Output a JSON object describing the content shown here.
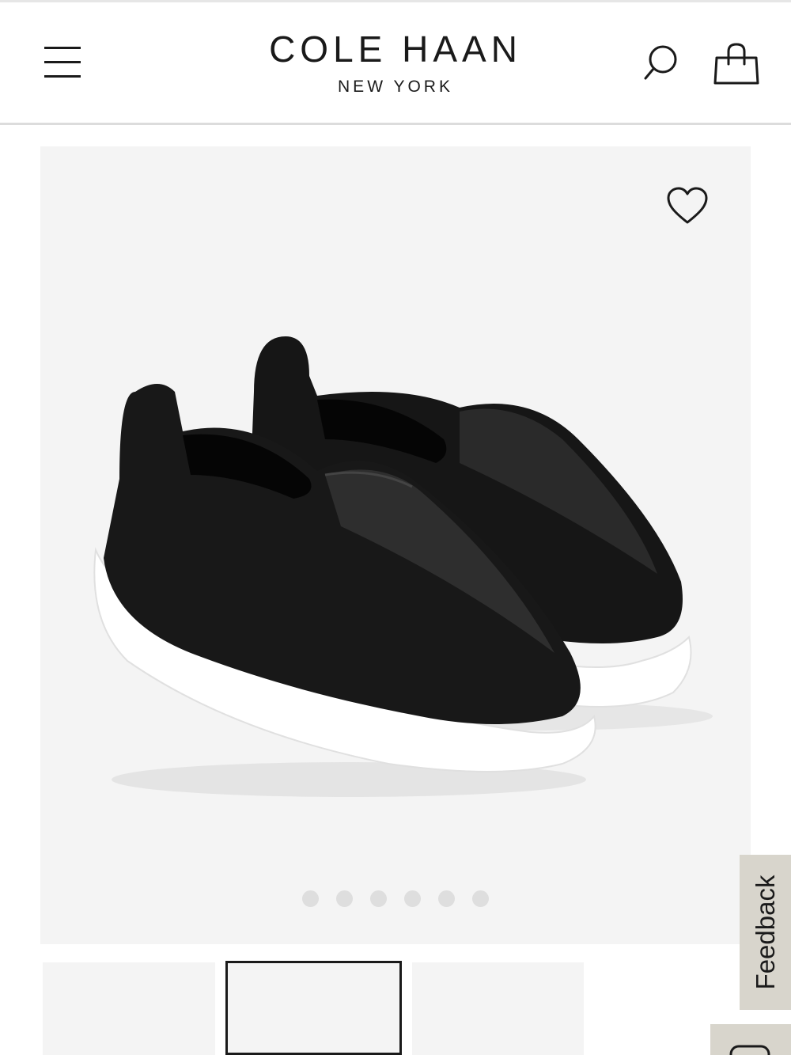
{
  "header": {
    "logo_main": "COLE HAAN",
    "logo_sub": "NEW YORK",
    "icons": {
      "menu": "hamburger-menu-icon",
      "search": "search-icon",
      "bag": "shopping-bag-icon"
    }
  },
  "gallery": {
    "wishlist_icon": "heart-outline-icon",
    "image_count": 6,
    "active_image_index": 0,
    "background_color": "#f4f4f4"
  },
  "thumbnails": {
    "count_visible": 3,
    "active_index": 1
  },
  "feedback": {
    "label": "Feedback"
  },
  "colors": {
    "text": "#1a1a1a",
    "feedback_bg": "#d8d5cc",
    "dot": "#dedede"
  }
}
